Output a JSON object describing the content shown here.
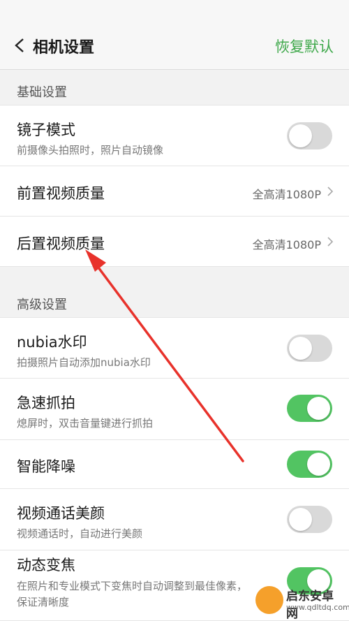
{
  "header": {
    "title": "相机设置",
    "restore_label": "恢复默认"
  },
  "sections": {
    "basic": {
      "label": "基础设置"
    },
    "advanced": {
      "label": "高级设置"
    }
  },
  "rows": {
    "mirror": {
      "title": "镜子模式",
      "subtitle": "前摄像头拍照时，照片自动镜像",
      "toggle_on": false
    },
    "front_video": {
      "title": "前置视频质量",
      "value": "全高清1080P"
    },
    "rear_video": {
      "title": "后置视频质量",
      "value": "全高清1080P"
    },
    "watermark": {
      "title": "nubia水印",
      "subtitle": "拍摄照片自动添加nubia水印",
      "toggle_on": false
    },
    "snap": {
      "title": "急速抓拍",
      "subtitle": "熄屏时，双击音量键进行抓拍",
      "toggle_on": true
    },
    "noise": {
      "title": "智能降噪",
      "toggle_on": true
    },
    "beauty": {
      "title": "视频通话美颜",
      "subtitle": "视频通话时，自动进行美颜",
      "toggle_on": false
    },
    "zoom": {
      "title": "动态变焦",
      "subtitle1": "在照片和专业模式下变焦时自动调整到最佳像素，",
      "subtitle2": "保证清晰度",
      "toggle_on": true
    }
  },
  "watermark_overlay": {
    "name": "启东安卓网",
    "url": "www.qdltdq.com"
  },
  "colors": {
    "accent": "#3ea84a",
    "toggle_on": "#52c462",
    "toggle_off": "#d9d9d9",
    "annotation": "#e8322b"
  },
  "icons": {
    "back": "chevron-left-icon",
    "row_arrow": "chevron-right-icon"
  }
}
